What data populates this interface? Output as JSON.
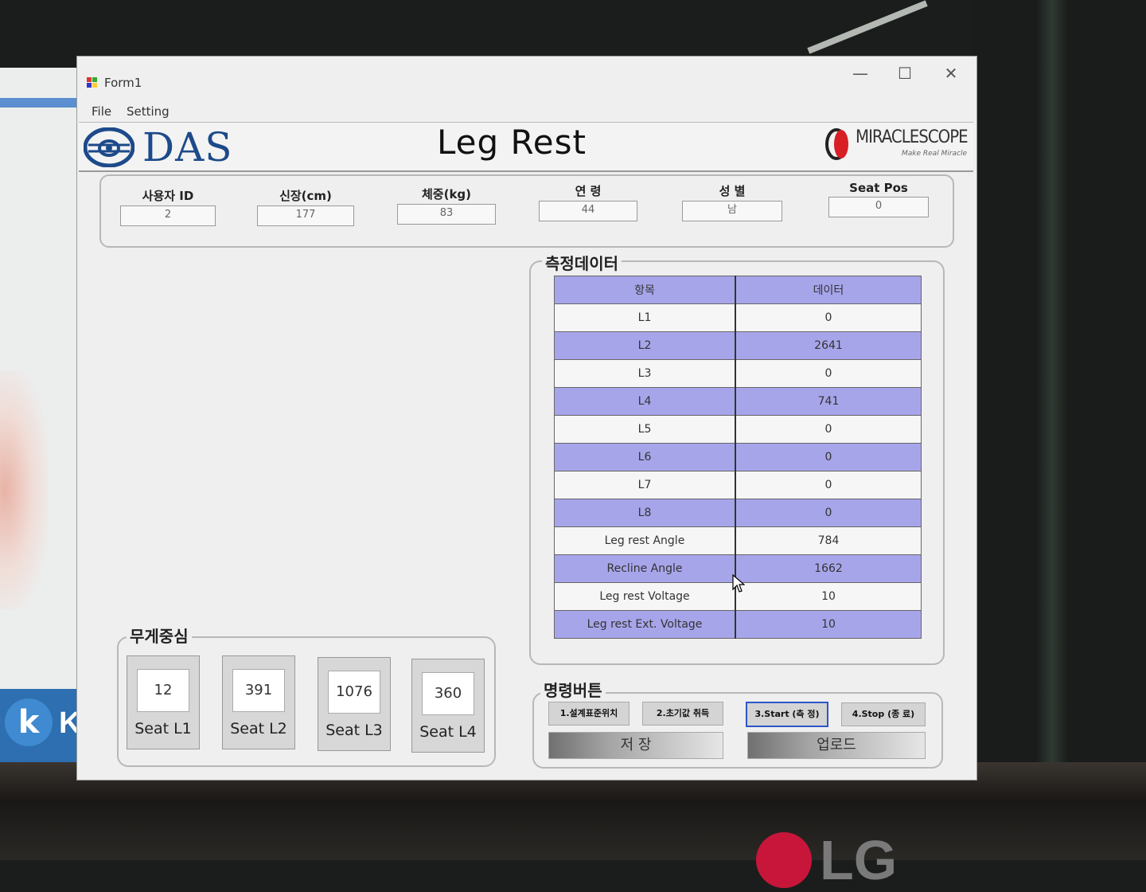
{
  "window": {
    "title": "Form1",
    "minimize": "—",
    "maximize": "☐",
    "close": "✕"
  },
  "menu": {
    "file": "File",
    "setting": "Setting"
  },
  "header": {
    "logo_text": "DAS",
    "title": "Leg Rest",
    "partner_logo": "MIRACLESCOPE",
    "partner_tagline": "Make Real Miracle"
  },
  "user": {
    "id_label": "사용자 ID",
    "id_value": "2",
    "height_label": "신장(cm)",
    "height_value": "177",
    "weight_label": "체중(kg)",
    "weight_value": "83",
    "age_label": "연 령",
    "age_value": "44",
    "gender_label": "성 별",
    "gender_value": "남",
    "seatpos_label": "Seat Pos",
    "seatpos_value": "0"
  },
  "measurement": {
    "title": "측정데이터",
    "col_item": "항목",
    "col_data": "데이터",
    "rows": [
      {
        "item": "L1",
        "data": "0"
      },
      {
        "item": "L2",
        "data": "2641"
      },
      {
        "item": "L3",
        "data": "0"
      },
      {
        "item": "L4",
        "data": "741"
      },
      {
        "item": "L5",
        "data": "0"
      },
      {
        "item": "L6",
        "data": "0"
      },
      {
        "item": "L7",
        "data": "0"
      },
      {
        "item": "L8",
        "data": "0"
      },
      {
        "item": "Leg rest Angle",
        "data": "784"
      },
      {
        "item": "Recline Angle",
        "data": "1662"
      },
      {
        "item": "Leg rest Voltage",
        "data": "10"
      },
      {
        "item": "Leg rest Ext. Voltage",
        "data": "10"
      }
    ]
  },
  "center_of_gravity": {
    "title": "무게중심",
    "seats": [
      {
        "value": "12",
        "label": "Seat L1"
      },
      {
        "value": "391",
        "label": "Seat L2"
      },
      {
        "value": "1076",
        "label": "Seat L3"
      },
      {
        "value": "360",
        "label": "Seat L4"
      }
    ]
  },
  "commands": {
    "title": "명령버튼",
    "btn1": "1.설계표준위치",
    "btn2": "2.초기값 취득",
    "btn3": "3.Start (측 정)",
    "btn4": "4.Stop (종 료)",
    "save": "저 장",
    "upload": "업로드"
  },
  "background": {
    "taskbar_app": "KIT",
    "brand": "LG"
  },
  "colors": {
    "table_highlight": "#a7a5ea",
    "logo_blue": "#1c4a8a",
    "active_border": "#2e55c8"
  }
}
